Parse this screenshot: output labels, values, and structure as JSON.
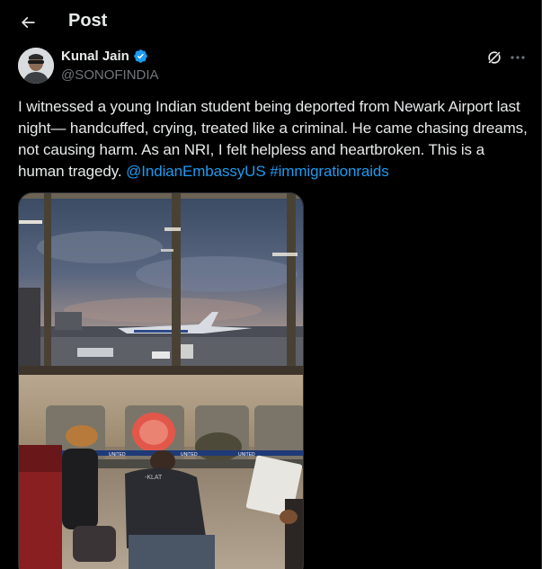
{
  "header": {
    "title": "Post",
    "back_icon": "arrow-left-icon"
  },
  "post": {
    "author": {
      "name": "Kunal Jain",
      "handle": "@SONOFINDIA",
      "verified": true,
      "verified_color": "#1d9bf0"
    },
    "text_segments": [
      {
        "type": "text",
        "value": "I witnessed a young Indian student being deported from Newark Airport last night— handcuffed, crying, treated like a criminal. He came chasing dreams, not causing harm. As an NRI, I felt helpless and heartbroken. This is a human tragedy. "
      },
      {
        "type": "mention",
        "value": "@IndianEmbassyUS"
      },
      {
        "type": "text",
        "value": " "
      },
      {
        "type": "hashtag",
        "value": "#immigrationraids"
      }
    ],
    "media": {
      "kind": "photo",
      "stanchion_brand": "UNITED"
    }
  },
  "colors": {
    "background": "#000000",
    "text": "#e7e9ea",
    "secondary": "#71767b",
    "link": "#1d9bf0"
  }
}
